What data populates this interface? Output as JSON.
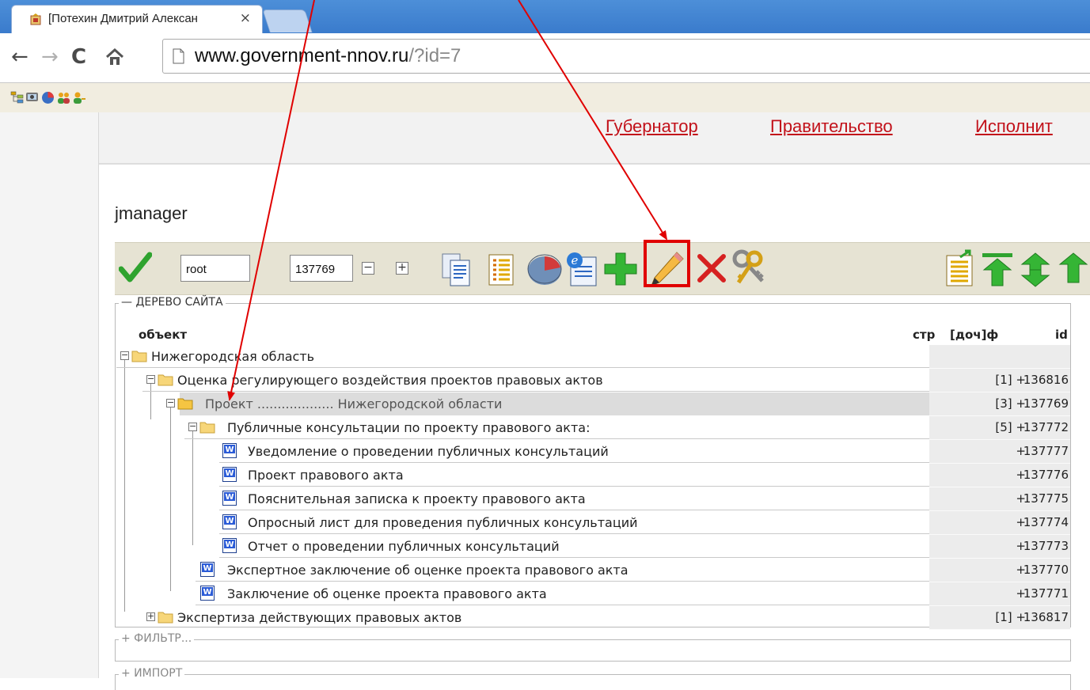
{
  "browser": {
    "tab_title": "[Потехин Дмитрий Алексан",
    "tab_close": "×",
    "url_host": "www.government-nnov.ru",
    "url_path": "/?id=7"
  },
  "site_nav": {
    "links": [
      "Губернатор",
      "Правительство",
      "Исполнит"
    ]
  },
  "app": {
    "title": "jmanager",
    "toolbar": {
      "root_value": "root",
      "id_value": "137769",
      "minus_label": "−",
      "plus_label": "+"
    }
  },
  "tree_panel": {
    "legend": "— ДЕРЕВО САЙТА",
    "columns": {
      "object": "объект",
      "pages": "стр",
      "docs": "[доч]ф",
      "id": "id"
    },
    "rows": [
      {
        "label": "Нижегородская область",
        "docs": "",
        "id": ""
      },
      {
        "label": "Оценка регулирующего воздействия проектов правовых актов",
        "docs": "[1] +",
        "id": "136816"
      },
      {
        "label": "Проект ................... Нижегородской области",
        "docs": "[3] +",
        "id": "137769"
      },
      {
        "label": "Публичные консультации по проекту правового акта:",
        "docs": "[5] +",
        "id": "137772"
      },
      {
        "label": "Уведомление о проведении публичных консультаций",
        "docs": "+",
        "id": "137777"
      },
      {
        "label": "Проект правового акта",
        "docs": "+",
        "id": "137776"
      },
      {
        "label": "Пояснительная записка к проекту правового акта",
        "docs": "+",
        "id": "137775"
      },
      {
        "label": "Опросный лист для проведения публичных консультаций",
        "docs": "+",
        "id": "137774"
      },
      {
        "label": "Отчет о проведении публичных консультаций",
        "docs": "+",
        "id": "137773"
      },
      {
        "label": "Экспертное заключение об оценке проекта правового акта",
        "docs": "+",
        "id": "137770"
      },
      {
        "label": "Заключение об оценке проекта правового акта",
        "docs": "+",
        "id": "137771"
      },
      {
        "label": "Экспертиза действующих правовых актов",
        "docs": "[1] +",
        "id": "136817"
      }
    ]
  },
  "filter_panel": {
    "legend": "+ ФИЛЬТР..."
  },
  "import_panel": {
    "legend": "+ ИМПОРТ"
  },
  "colors": {
    "accent_red": "#e00000",
    "link_red": "#c2111a",
    "toolbar_bg": "#e6e3d3"
  }
}
